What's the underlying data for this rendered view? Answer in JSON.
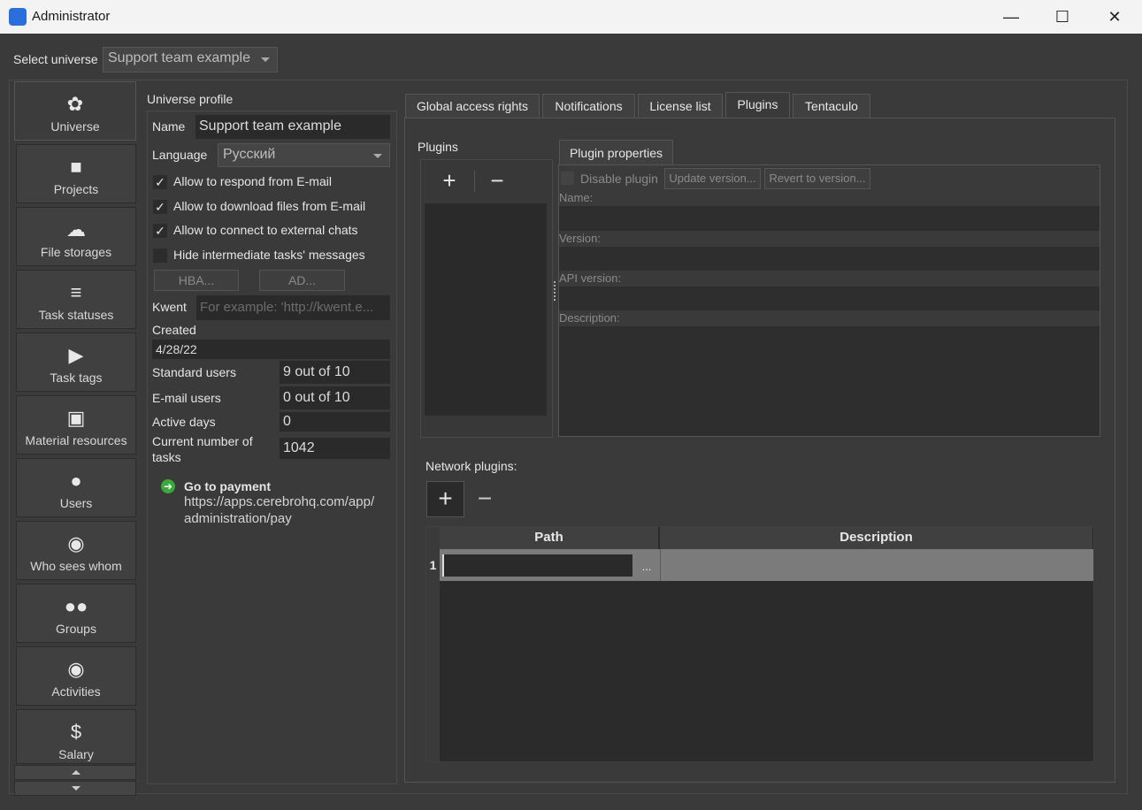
{
  "window": {
    "title": "Administrator"
  },
  "universe_select": {
    "label": "Select universe",
    "value": "Support team example"
  },
  "sidebar": {
    "items": [
      {
        "label": "Universe",
        "icon": "universe-icon"
      },
      {
        "label": "Projects",
        "icon": "folder-icon"
      },
      {
        "label": "File storages",
        "icon": "cloud-icon"
      },
      {
        "label": "Task statuses",
        "icon": "task-status-icon"
      },
      {
        "label": "Task tags",
        "icon": "tag-icon"
      },
      {
        "label": "Material resources",
        "icon": "inbox-icon"
      },
      {
        "label": "Users",
        "icon": "user-icon"
      },
      {
        "label": "Who sees whom",
        "icon": "eye-icon"
      },
      {
        "label": "Groups",
        "icon": "group-icon"
      },
      {
        "label": "Activities",
        "icon": "palette-icon"
      },
      {
        "label": "Salary",
        "icon": "dollar-icon"
      }
    ]
  },
  "profile": {
    "heading": "Universe profile",
    "name_label": "Name",
    "name_value": "Support team example",
    "language_label": "Language",
    "language_value": "Русский",
    "checks": [
      {
        "label": "Allow to respond from E-mail",
        "checked": "✓"
      },
      {
        "label": "Allow to download files from E-mail",
        "checked": "✓"
      },
      {
        "label": "Allow to connect to external chats",
        "checked": "✓"
      },
      {
        "label": "Hide intermediate tasks' messages",
        "checked": ""
      }
    ],
    "hba_button": "HBA...",
    "ad_button": "AD...",
    "kwent_label": "Kwent",
    "kwent_placeholder": "For example: 'http://kwent.e...",
    "created_label": "Created",
    "created_value": "4/28/22",
    "standard_users_label": "Standard users",
    "standard_users_value": "9 out of 10",
    "email_users_label": "E-mail users",
    "email_users_value": "0 out of 10",
    "active_days_label": "Active days",
    "active_days_value": "0",
    "tasks_label_1": "Current number of",
    "tasks_label_2": "tasks",
    "tasks_value": "1042",
    "payment_title": "Go to payment",
    "payment_url_1": "https://apps.cerebrohq.com/app/",
    "payment_url_2": "administration/pay"
  },
  "tabs": [
    "Global access rights",
    "Notifications",
    "License list",
    "Plugins",
    "Tentaculo"
  ],
  "plugins": {
    "heading": "Plugins",
    "add": "+",
    "remove": "−",
    "properties_tab": "Plugin properties",
    "disable_label": "Disable plugin",
    "update_button": "Update version...",
    "revert_button": "Revert to version...",
    "name_label": "Name:",
    "version_label": "Version:",
    "api_label": "API version:",
    "description_label": "Description:"
  },
  "network_plugins": {
    "heading": "Network plugins:",
    "add": "+",
    "remove": "−",
    "columns": [
      "Path",
      "Description"
    ],
    "rows": [
      {
        "num": "1",
        "path": "",
        "browse": "..."
      }
    ]
  }
}
